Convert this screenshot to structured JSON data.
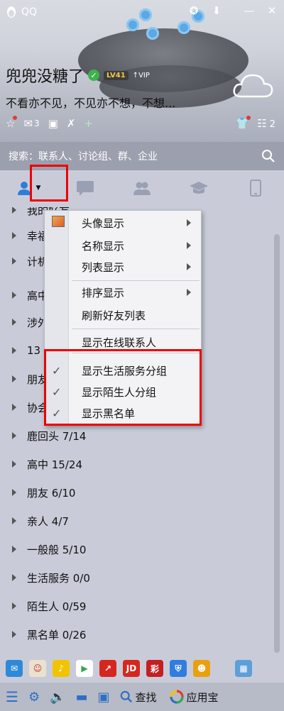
{
  "window": {
    "title": "QQ"
  },
  "profile": {
    "nickname": "兜兜没糖了",
    "level": "LV41",
    "vip": "VIP",
    "signature": "不看亦不见，不见亦不想，不想..."
  },
  "header_icons": {
    "mail_count": "3",
    "messages_count": "2"
  },
  "search": {
    "placeholder": "搜索：联系人、讨论组、群、企业"
  },
  "tabs": [
    {
      "name": "contacts",
      "icon": "person-icon"
    },
    {
      "name": "messages",
      "icon": "chat-icon"
    },
    {
      "name": "groups",
      "icon": "group-icon"
    },
    {
      "name": "education",
      "icon": "graduation-cap-icon"
    },
    {
      "name": "devices",
      "icon": "phone-icon"
    }
  ],
  "groups": [
    {
      "label": "我的好友"
    },
    {
      "label": "幸福"
    },
    {
      "label": "计机"
    },
    {
      "label": "高中"
    },
    {
      "label": "涉外"
    },
    {
      "label": "13"
    },
    {
      "label": "朋友"
    },
    {
      "label": "协会"
    },
    {
      "label": "鹿回头 7/14"
    },
    {
      "label": "高中 15/24"
    },
    {
      "label": "朋友 6/10"
    },
    {
      "label": "亲人 4/7"
    },
    {
      "label": "一般般 5/10"
    },
    {
      "label": "生活服务 0/0"
    },
    {
      "label": "陌生人 0/59"
    },
    {
      "label": "黑名单 0/26"
    }
  ],
  "menu": {
    "items": [
      {
        "label": "头像显示",
        "submenu": true
      },
      {
        "label": "名称显示",
        "submenu": true
      },
      {
        "label": "列表显示",
        "submenu": true
      },
      {
        "label": "排序显示",
        "submenu": true
      },
      {
        "label": "刷新好友列表",
        "submenu": false
      },
      {
        "label": "显示在线联系人",
        "submenu": false
      },
      {
        "label": "显示生活服务分组",
        "checked": true
      },
      {
        "label": "显示陌生人分组",
        "checked": true
      },
      {
        "label": "显示黑名单",
        "checked": true
      }
    ]
  },
  "apps": [
    "mail",
    "game",
    "music",
    "video",
    "stock",
    "JD",
    "彩",
    "shield",
    "pet",
    "more"
  ],
  "bottom": {
    "find_label": "查找",
    "appstore_label": "应用宝"
  },
  "colors": {
    "highlight": "#e00000",
    "accent": "#2b7fd9"
  }
}
